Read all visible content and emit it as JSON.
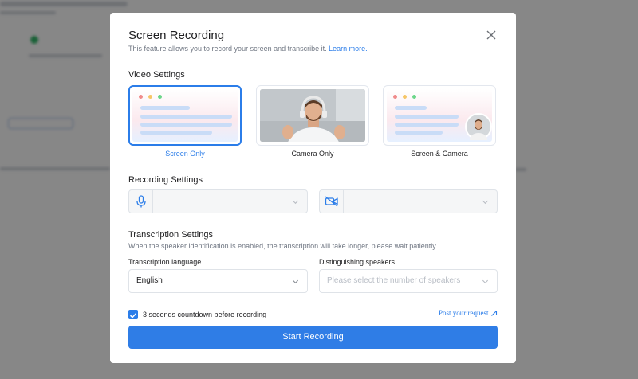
{
  "dialog": {
    "title": "Screen Recording",
    "subtitle": "This feature allows you to record your screen and transcribe it.",
    "learn_more": "Learn more."
  },
  "video_settings": {
    "heading": "Video Settings",
    "options": [
      {
        "label": "Screen Only",
        "selected": true
      },
      {
        "label": "Camera Only",
        "selected": false
      },
      {
        "label": "Screen & Camera",
        "selected": false
      }
    ]
  },
  "recording_settings": {
    "heading": "Recording Settings",
    "microphone_value": "",
    "camera_value": ""
  },
  "transcription_settings": {
    "heading": "Transcription Settings",
    "hint": "When the speaker identification is enabled, the transcription will take longer, please wait patiently.",
    "language_label": "Transcription language",
    "language_value": "English",
    "speakers_label": "Distinguishing speakers",
    "speakers_placeholder": "Please select the number of speakers"
  },
  "countdown": {
    "label": "3 seconds countdown before recording",
    "checked": true
  },
  "post_request": "Post your request",
  "start_button": "Start Recording",
  "colors": {
    "accent": "#2b7de9",
    "overlay": "rgba(0,0,0,0.47)"
  }
}
